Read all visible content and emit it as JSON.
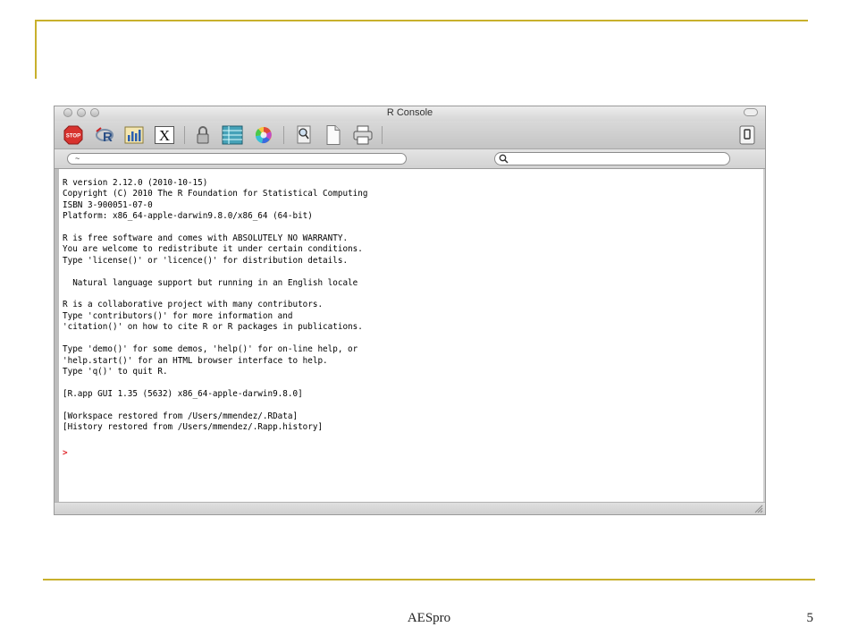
{
  "window": {
    "title": "R Console"
  },
  "toolbar": {
    "icons": [
      "stop-icon",
      "r-source-icon",
      "bar-chart-icon",
      "x11-icon",
      "lock-icon",
      "data-table-icon",
      "color-wheel-icon",
      "document-search-icon",
      "new-document-icon",
      "print-icon",
      "sidebar-toggle-icon"
    ],
    "stop_label": "STOP",
    "x11_label": "X"
  },
  "path": {
    "value": "~"
  },
  "search": {
    "value": ""
  },
  "console": {
    "lines": [
      "R version 2.12.0 (2010-10-15)",
      "Copyright (C) 2010 The R Foundation for Statistical Computing",
      "ISBN 3-900051-07-0",
      "Platform: x86_64-apple-darwin9.8.0/x86_64 (64-bit)",
      "",
      "R is free software and comes with ABSOLUTELY NO WARRANTY.",
      "You are welcome to redistribute it under certain conditions.",
      "Type 'license()' or 'licence()' for distribution details.",
      "",
      "  Natural language support but running in an English locale",
      "",
      "R is a collaborative project with many contributors.",
      "Type 'contributors()' for more information and",
      "'citation()' on how to cite R or R packages in publications.",
      "",
      "Type 'demo()' for some demos, 'help()' for on-line help, or",
      "'help.start()' for an HTML browser interface to help.",
      "Type 'q()' to quit R.",
      "",
      "[R.app GUI 1.35 (5632) x86_64-apple-darwin9.8.0]",
      "",
      "[Workspace restored from /Users/mmendez/.RData]",
      "[History restored from /Users/mmendez/.Rapp.history]"
    ],
    "prompt": ">"
  },
  "slide": {
    "footer": "AESpro",
    "page_number": "5",
    "accent_color": "#c8b02c"
  }
}
